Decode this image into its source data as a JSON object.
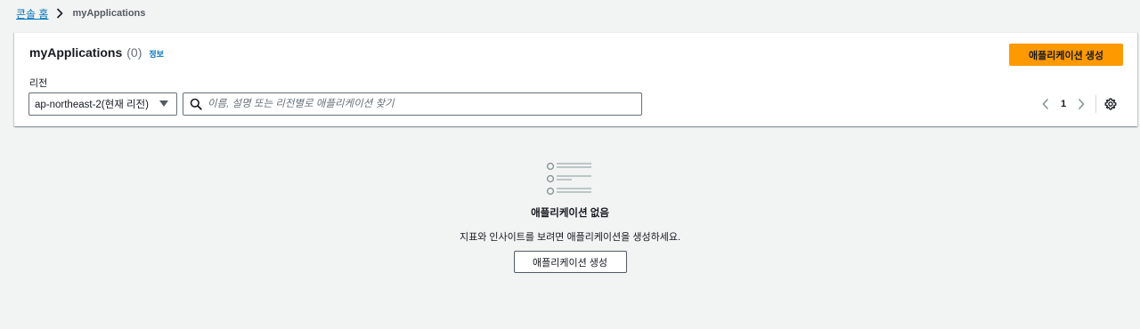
{
  "breadcrumb": {
    "home_label": "콘솔 홈",
    "current_label": "myApplications"
  },
  "header": {
    "title": "myApplications",
    "count": "(0)",
    "info_label": "정보",
    "create_button_label": "애플리케이션 생성"
  },
  "filter": {
    "region_label": "리전",
    "region_value": "ap-northeast-2(현재 리전)",
    "search_placeholder": "이름, 설명 또는 리전별로 애플리케이션 찾기"
  },
  "pagination": {
    "current_page": "1"
  },
  "empty_state": {
    "title": "애플리케이션 없음",
    "description": "지표와 인사이트를 보려면 애플리케이션을 생성하세요.",
    "button_label": "애플리케이션 생성"
  },
  "icons": {
    "breadcrumb_separator": "chevron-right-icon",
    "search": "search-icon",
    "prev_page": "chevron-left-icon",
    "next_page": "chevron-right-icon",
    "settings": "gear-icon",
    "dropdown": "caret-down-icon",
    "empty": "list-icon"
  },
  "colors": {
    "primary_button": "#ff9900",
    "link": "#0073bb",
    "background": "#f2f3f3"
  }
}
